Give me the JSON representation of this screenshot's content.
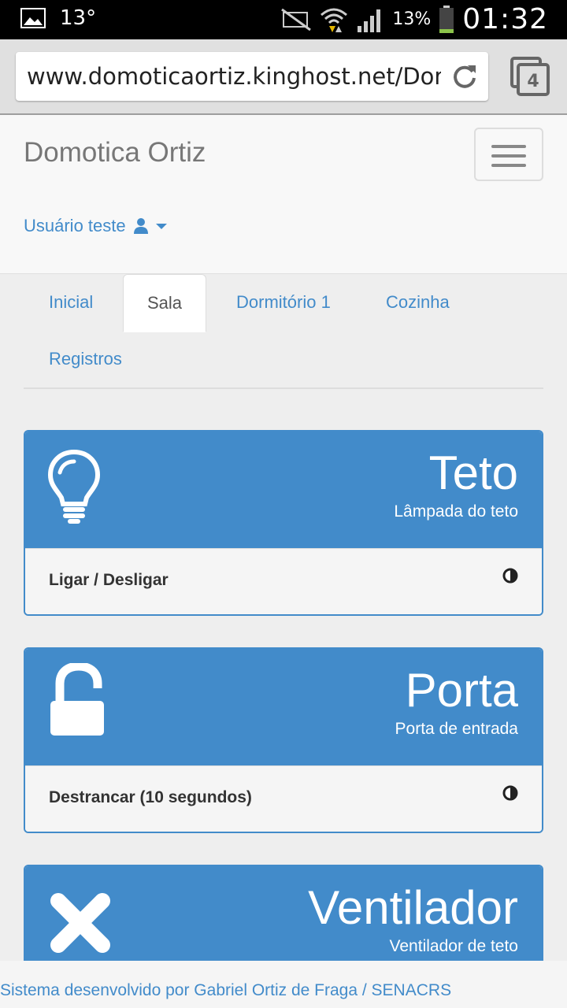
{
  "status_bar": {
    "temperature": "13°",
    "battery_percent": "13%",
    "time": "01:32",
    "battery_color": "#8bc34a"
  },
  "browser": {
    "url": "www.domoticaortiz.kinghost.net/Domo",
    "tab_count": "4"
  },
  "navbar": {
    "brand": "Domotica Ortiz",
    "user_label": "Usuário teste"
  },
  "tabs": [
    {
      "label": "Inicial",
      "active": false
    },
    {
      "label": "Sala",
      "active": true
    },
    {
      "label": "Dormitório 1",
      "active": false
    },
    {
      "label": "Cozinha",
      "active": false
    },
    {
      "label": "Registros",
      "active": false
    }
  ],
  "devices": [
    {
      "title": "Teto",
      "subtitle": "Lâmpada do teto",
      "action": "Ligar / Desligar",
      "icon": "lightbulb-icon"
    },
    {
      "title": "Porta",
      "subtitle": "Porta de entrada",
      "action": "Destrancar (10 segundos)",
      "icon": "unlock-icon"
    },
    {
      "title": "Ventilador",
      "subtitle": "Ventilador de teto",
      "icon": "remove-icon"
    }
  ],
  "footer": {
    "credit": "Sistema desenvolvido por Gabriel Ortiz de Fraga / SENACRS"
  },
  "colors": {
    "primary": "#428bca",
    "navbar_bg": "#f8f8f8",
    "page_bg": "#eeeeee"
  }
}
